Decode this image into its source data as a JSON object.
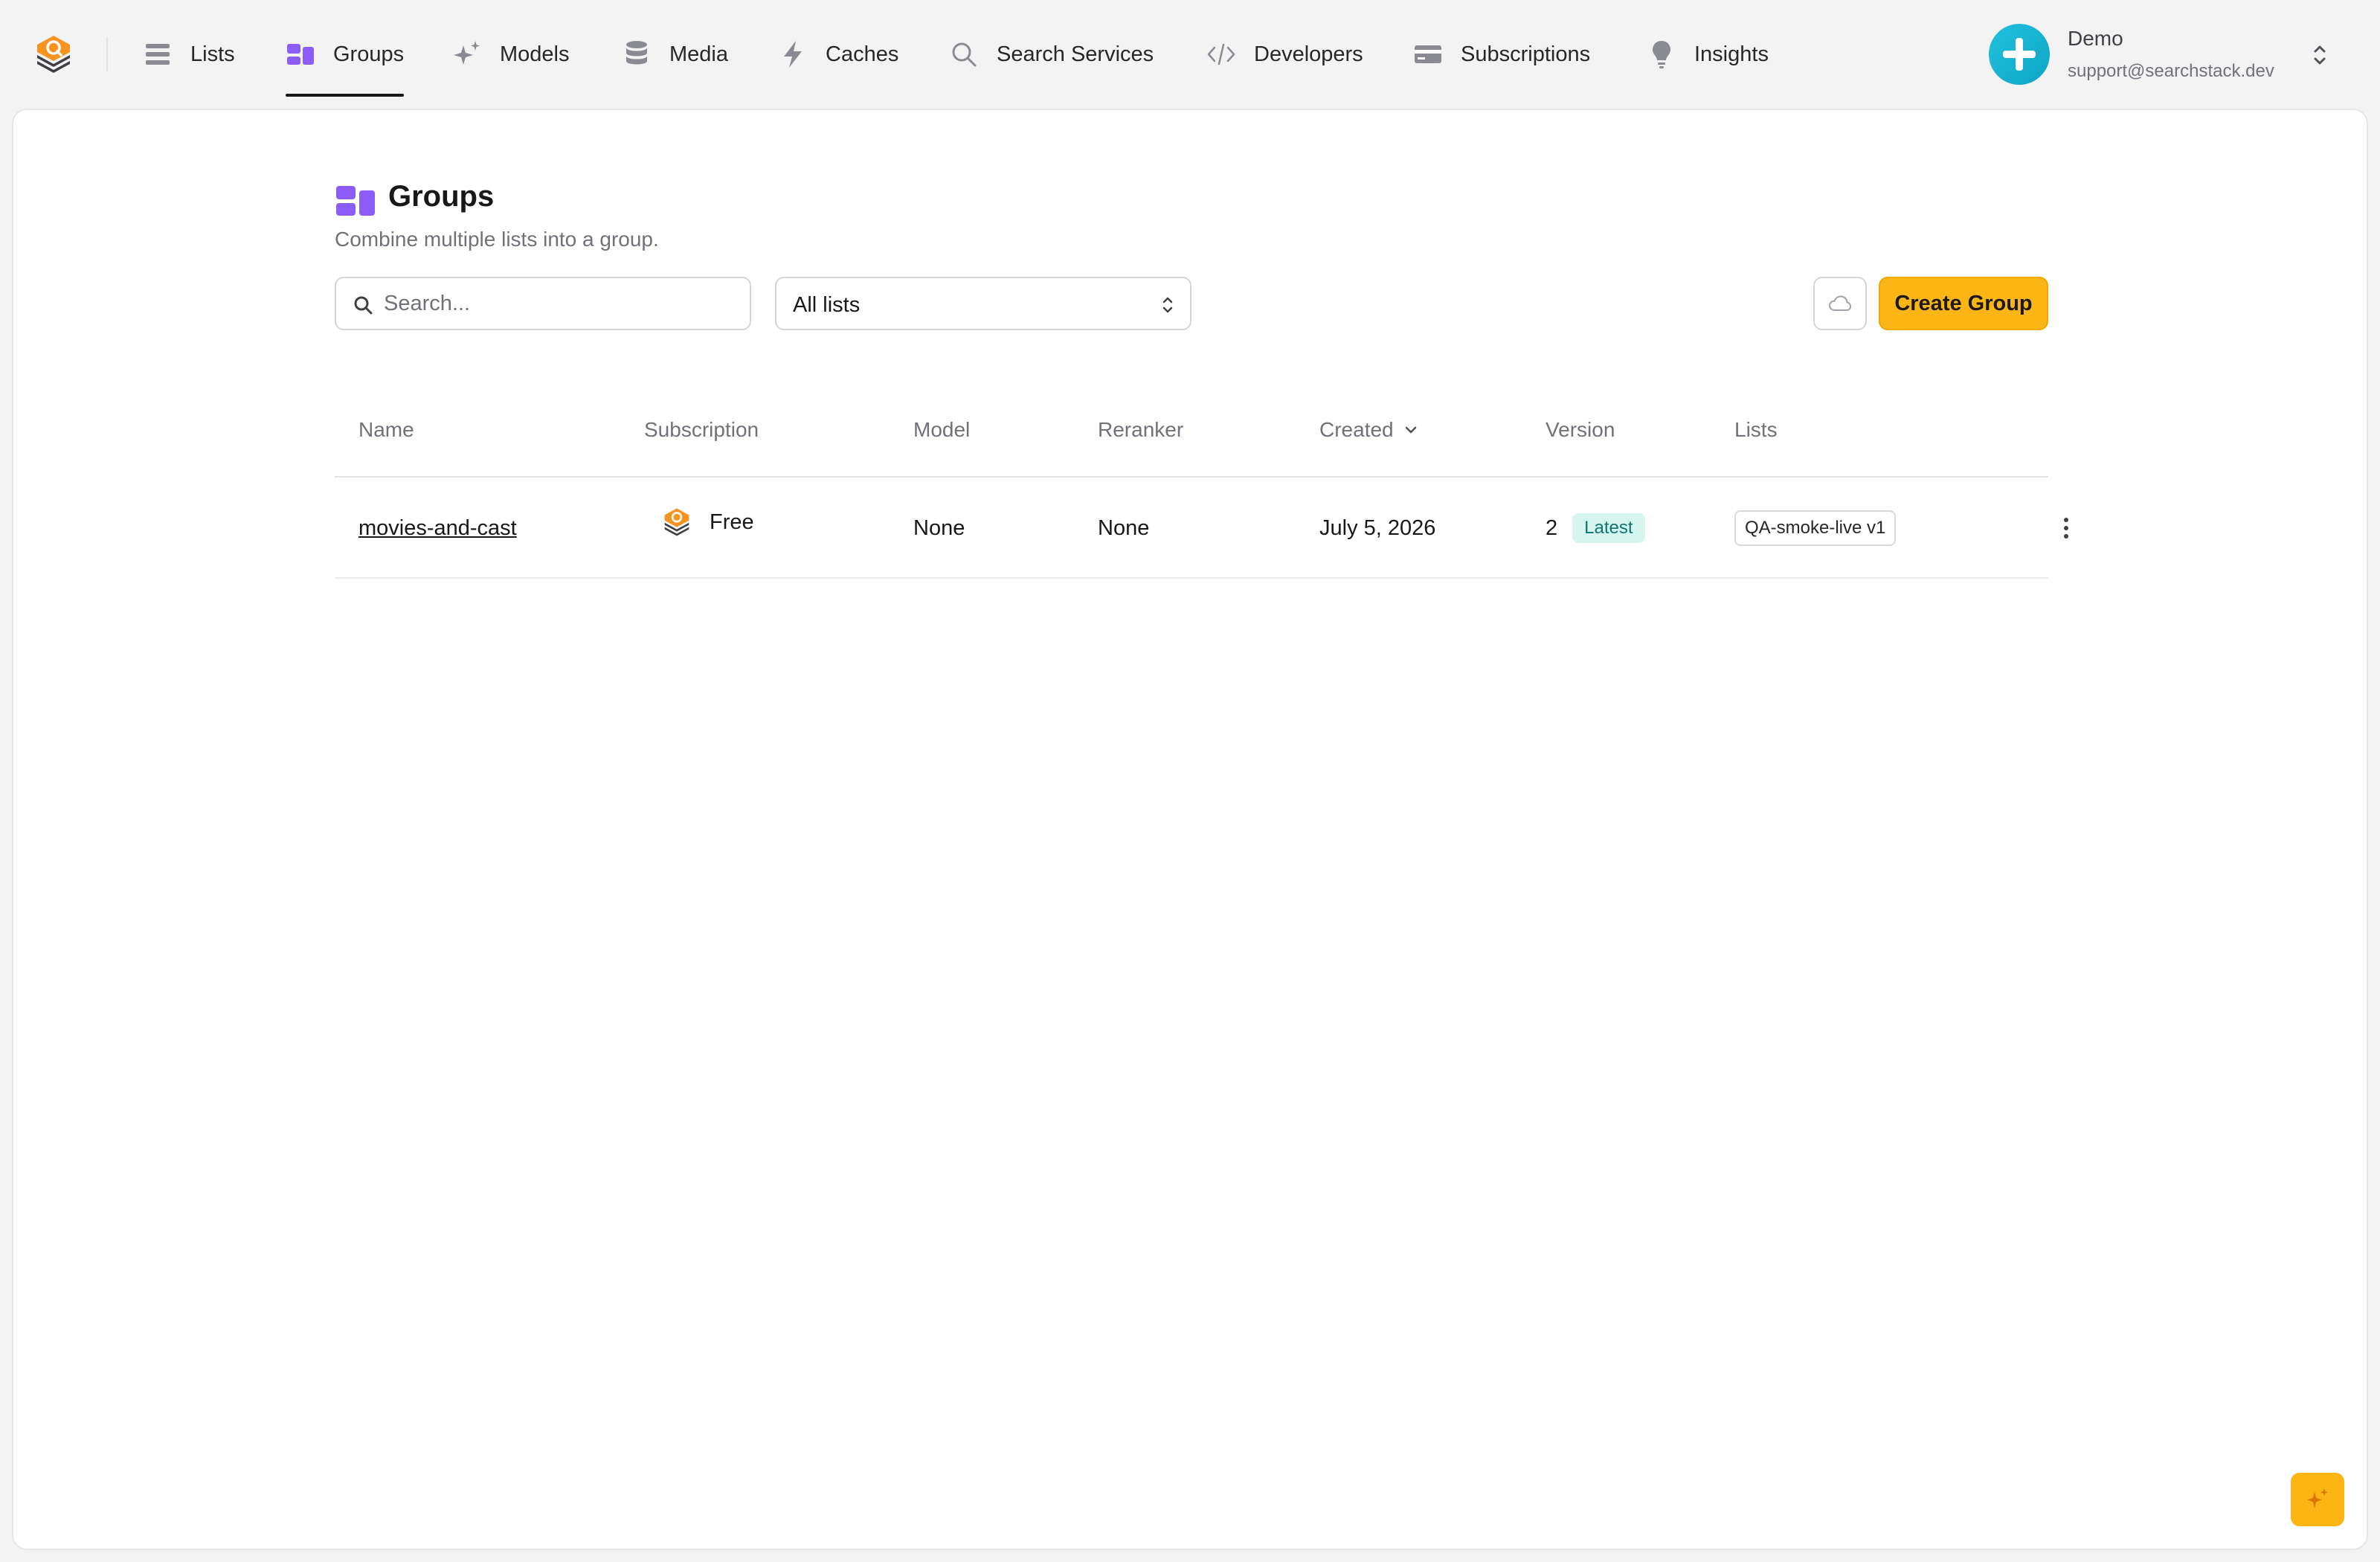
{
  "nav": {
    "items": [
      {
        "label": "Lists",
        "icon": "list-icon"
      },
      {
        "label": "Groups",
        "icon": "groups-icon",
        "active": true
      },
      {
        "label": "Models",
        "icon": "sparkles-icon"
      },
      {
        "label": "Media",
        "icon": "database-icon"
      },
      {
        "label": "Caches",
        "icon": "bolt-icon"
      },
      {
        "label": "Search Services",
        "icon": "search-icon"
      },
      {
        "label": "Developers",
        "icon": "code-icon"
      },
      {
        "label": "Subscriptions",
        "icon": "credit-card-icon"
      },
      {
        "label": "Insights",
        "icon": "lightbulb-icon"
      }
    ]
  },
  "user": {
    "name": "Demo",
    "email": "support@searchstack.dev"
  },
  "page": {
    "title": "Groups",
    "subtitle": "Combine multiple lists into a group."
  },
  "toolbar": {
    "search_placeholder": "Search...",
    "filter_value": "All lists",
    "create_label": "Create Group"
  },
  "table": {
    "headers": {
      "name": "Name",
      "subscription": "Subscription",
      "model": "Model",
      "reranker": "Reranker",
      "created": "Created",
      "version": "Version",
      "lists": "Lists"
    },
    "rows": [
      {
        "name": "movies-and-cast",
        "subscription": "Free",
        "model": "None",
        "reranker": "None",
        "created": "July 5, 2026",
        "version": "2",
        "version_badge": "Latest",
        "lists": "QA-smoke-live v1"
      }
    ]
  },
  "colors": {
    "accent": "#fbb514",
    "groups_purple": "#8b5cf6",
    "avatar": "#16b4d4",
    "latest_badge_bg": "#d6f5ee",
    "latest_badge_text": "#0f766e"
  }
}
